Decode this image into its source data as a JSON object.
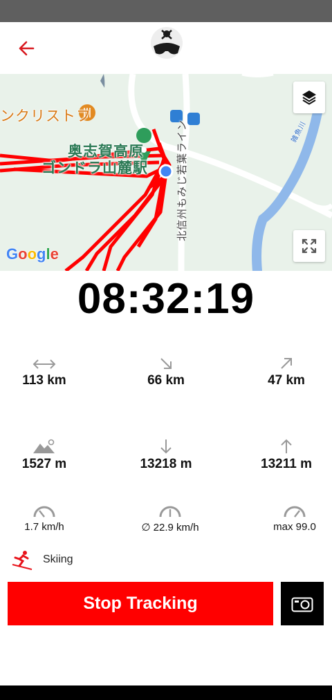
{
  "header": {
    "back_icon": "arrow-left-icon",
    "logo_icon": "skull-goggles-logo"
  },
  "map": {
    "labels": {
      "place": "奥志賀高原",
      "station": "ゴンドラ山麓駅",
      "restaurant": "ンクリストフ",
      "road": "北信州もみじ若葉ライン",
      "river": "雑魚川"
    },
    "google": [
      "G",
      "o",
      "o",
      "g",
      "l",
      "e"
    ],
    "buttons": {
      "layers_icon": "layers-icon",
      "fullscreen_icon": "fullscreen-icon"
    }
  },
  "timer": "08:32:19",
  "stats": {
    "distance": "113 km",
    "downhill_distance": "66 km",
    "uphill_distance": "47 km",
    "altitude": "1527 m",
    "descent": "13218 m",
    "ascent": "13211 m",
    "speed": "1.7 km/h",
    "avg_speed": "∅ 22.9 km/h",
    "max_speed": "max 99.0"
  },
  "activity": {
    "label": "Skiing",
    "icon": "skier-icon"
  },
  "actions": {
    "stop_label": "Stop Tracking",
    "camera_icon": "camera-icon"
  },
  "colors": {
    "accent": "#ff0000",
    "map_green": "#e9f2ea",
    "river": "#8fb8ea"
  }
}
